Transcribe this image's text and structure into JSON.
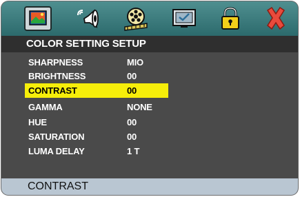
{
  "toolbar": {
    "icons": [
      {
        "name": "picture-icon",
        "selected": true
      },
      {
        "name": "speaker-icon",
        "selected": false
      },
      {
        "name": "film-reel-icon",
        "selected": false
      },
      {
        "name": "monitor-check-icon",
        "selected": false
      },
      {
        "name": "lock-icon",
        "selected": false
      },
      {
        "name": "close-icon",
        "selected": false
      }
    ]
  },
  "title": "COLOR SETTING SETUP",
  "menu": {
    "selected_index": 2,
    "items": [
      {
        "label": "SHARPNESS",
        "value": "MIO"
      },
      {
        "label": "BRIGHTNESS",
        "value": "00"
      },
      {
        "label": "CONTRAST",
        "value": "00"
      },
      {
        "label": "GAMMA",
        "value": "NONE"
      },
      {
        "label": "HUE",
        "value": "00"
      },
      {
        "label": "SATURATION",
        "value": "00"
      },
      {
        "label": "LUMA DELAY",
        "value": "1 T"
      }
    ]
  },
  "status": {
    "text": "CONTRAST"
  },
  "colors": {
    "toolbar": "#3d7e80",
    "panel": "#4a4a4a",
    "highlight": "#f6ee0a",
    "status_bar": "#b9c6d2"
  }
}
